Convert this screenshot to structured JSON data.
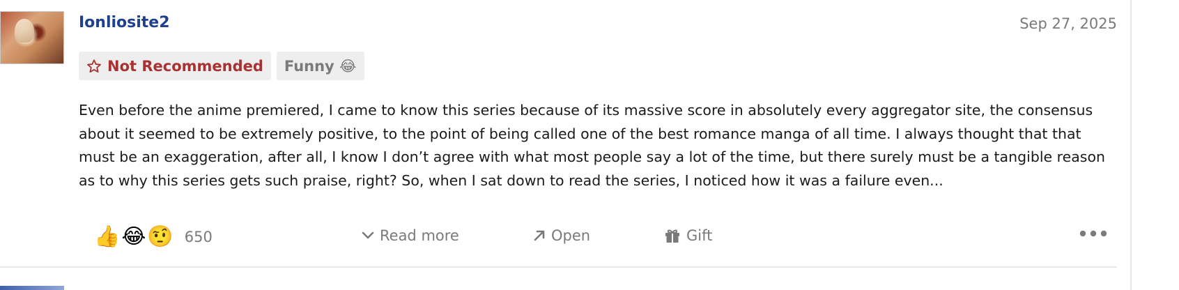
{
  "review": {
    "username": "Ionliosite2",
    "date": "Sep 27, 2025",
    "tags": {
      "recommendation": "Not Recommended",
      "funny": "Funny 😂"
    },
    "body": "Even before the anime premiered, I came to know this series because of its massive score in absolutely every aggregator site, the consensus about it seemed to be extremely positive, to the point of being called one of the best romance manga of all time. I always thought that that must be an exaggeration, after all, I know I don’t agree with what most people say a lot of the time, but there surely must be a tangible reason as to why this series gets such praise, right? So, when I sat down to read the series, I noticed how it was a failure even...",
    "reactions": {
      "emojis": [
        "👍",
        "😂",
        "🤨"
      ],
      "count": "650"
    },
    "actions": {
      "read_more": "Read more",
      "open": "Open",
      "gift": "Gift"
    }
  },
  "colors": {
    "username": "#1f3f8f",
    "not_recommended": "#a83232",
    "muted": "#7a7a7a",
    "tag_bg": "#eeeeee"
  },
  "icons": {
    "recommendation": "star-outline-icon",
    "read_more": "chevron-down-icon",
    "open": "arrow-up-right-icon",
    "gift": "gift-icon",
    "more": "more-dots-icon"
  }
}
